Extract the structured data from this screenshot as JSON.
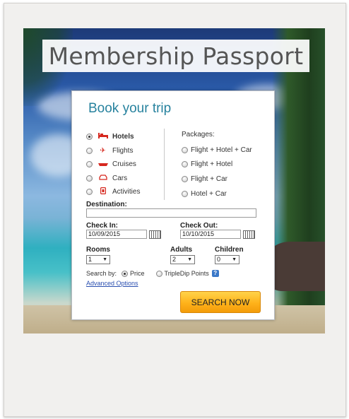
{
  "banner": {
    "title": "Membership Passport"
  },
  "booking": {
    "title": "Book your trip",
    "types": [
      {
        "label": "Hotels",
        "icon": "bed-icon",
        "selected": true
      },
      {
        "label": "Flights",
        "icon": "plane-icon",
        "selected": false
      },
      {
        "label": "Cruises",
        "icon": "ship-icon",
        "selected": false
      },
      {
        "label": "Cars",
        "icon": "car-icon",
        "selected": false
      },
      {
        "label": "Activities",
        "icon": "ticket-icon",
        "selected": false
      }
    ],
    "packages": {
      "title": "Packages:",
      "options": [
        "Flight + Hotel + Car",
        "Flight + Hotel",
        "Flight + Car",
        "Hotel + Car"
      ]
    },
    "destination": {
      "label": "Destination:",
      "value": ""
    },
    "check_in": {
      "label": "Check In:",
      "value": "10/09/2015"
    },
    "check_out": {
      "label": "Check Out:",
      "value": "10/10/2015"
    },
    "rooms": {
      "label": "Rooms",
      "value": "1"
    },
    "adults": {
      "label": "Adults",
      "value": "2"
    },
    "children": {
      "label": "Children",
      "value": "0"
    },
    "search_by": {
      "label": "Search by:",
      "price": "Price",
      "points": "TripleDip Points",
      "help": "?",
      "selected": "price"
    },
    "advanced": "Advanced Options",
    "search_button": "SEARCH NOW"
  },
  "colors": {
    "title": "#27829e",
    "button": "#ffb21a",
    "link": "#2a4fb0",
    "icon": "#d6281f"
  }
}
